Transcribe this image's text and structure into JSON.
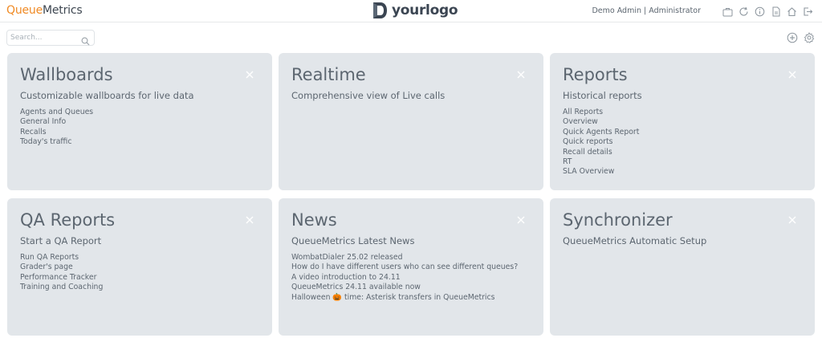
{
  "header": {
    "brand_part1": "Queue",
    "brand_part2": "Metrics",
    "logo_text": "yourlogo",
    "user": "Demo Admin | Administrator",
    "icons": [
      "briefcase-icon",
      "refresh-icon",
      "info-icon",
      "document-icon",
      "home-icon",
      "logout-icon"
    ]
  },
  "search": {
    "placeholder": "Search..."
  },
  "tools": {
    "icons": [
      "add-circle-icon",
      "settings-gear-icon"
    ]
  },
  "cards": [
    {
      "title": "Wallboards",
      "subtitle": "Customizable wallboards for live data",
      "items": [
        "Agents and Queues",
        "General Info",
        "Recalls",
        "Today's traffic"
      ]
    },
    {
      "title": "Realtime",
      "subtitle": "Comprehensive view of Live calls",
      "items": []
    },
    {
      "title": "Reports",
      "subtitle": "Historical reports",
      "items": [
        "All Reports",
        "Overview",
        "Quick Agents Report",
        "Quick reports",
        "Recall details",
        "RT",
        "SLA Overview"
      ]
    },
    {
      "title": "QA Reports",
      "subtitle": "Start a QA Report",
      "items": [
        "Run QA Reports",
        "Grader's page",
        "Performance Tracker",
        "Training and Coaching"
      ]
    },
    {
      "title": "News",
      "subtitle": "QueueMetrics Latest News",
      "items": [
        "WombatDialer 25.02 released",
        "How do I have different users who can see different queues?",
        "A video introduction to 24.11",
        "QueueMetrics 24.11 available now",
        "Halloween 🎃 time: Asterisk transfers in QueueMetrics"
      ]
    },
    {
      "title": "Synchronizer",
      "subtitle": "QueueMetrics Automatic Setup",
      "items": []
    }
  ],
  "colors": {
    "accent": "#f08a24",
    "card_bg": "#e2e6ea",
    "text": "#5c6670"
  }
}
